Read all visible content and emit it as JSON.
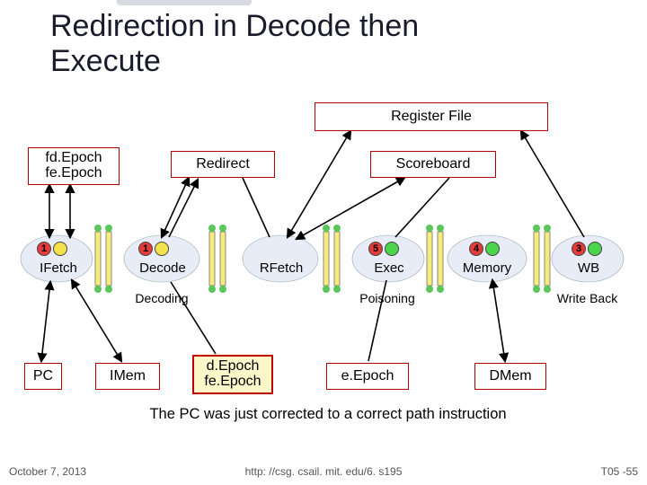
{
  "title_line1": "Redirection in Decode then",
  "title_line2": "Execute",
  "regfile": "Register File",
  "fd_epoch": "fd.Epoch",
  "fe_epoch": "fe.Epoch",
  "redirect": "Redirect",
  "scoreboard": "Scoreboard",
  "stages": {
    "ifetch": "IFetch",
    "decode": "Decode",
    "rfetch": "RFetch",
    "exec": "Exec",
    "memory": "Memory",
    "wb": "WB"
  },
  "stage_numbers": {
    "ifetch": "1",
    "decode": "1",
    "exec": "5",
    "memory": "4",
    "wb": "3"
  },
  "sub": {
    "decoding": "Decoding",
    "poisoning": "Poisoning",
    "writeback": "Write Back"
  },
  "pc": "PC",
  "imem": "IMem",
  "d_epoch": "d.Epoch",
  "fe_epoch2": "fe.Epoch",
  "e_epoch": "e.Epoch",
  "dmem": "DMem",
  "caption": "The PC was just corrected to a correct path instruction",
  "footer": {
    "date": "October 7, 2013",
    "url": "http: //csg. csail. mit. edu/6. s195",
    "tag": "T05 -55"
  }
}
